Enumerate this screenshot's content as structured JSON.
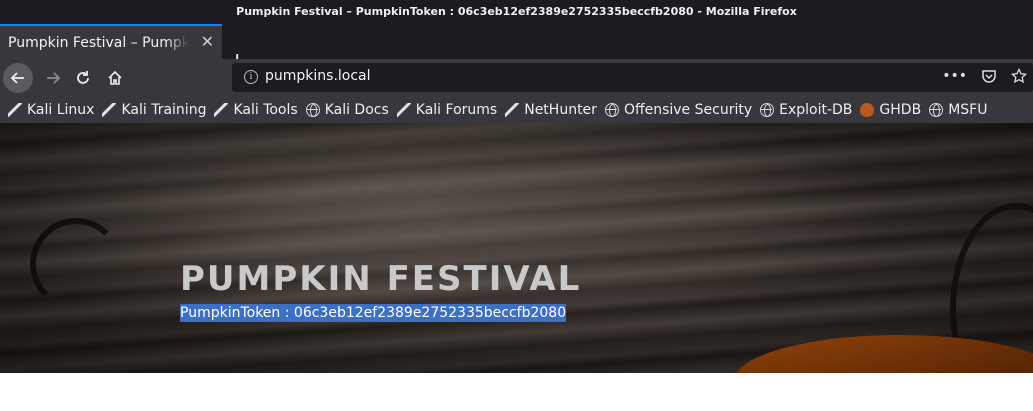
{
  "window": {
    "title": "Pumpkin Festival – PumpkinToken : 06c3eb12ef2389e2752335beccfb2080 - Mozilla Firefox"
  },
  "tabs": [
    {
      "label": "Pumpkin Festival – Pumpkin"
    }
  ],
  "navigation": {
    "url": "pumpkins.local",
    "page_actions": "•••"
  },
  "bookmarks": [
    {
      "label": "Kali Linux",
      "icon": "kali-icon"
    },
    {
      "label": "Kali Training",
      "icon": "kali-icon"
    },
    {
      "label": "Kali Tools",
      "icon": "kali-icon"
    },
    {
      "label": "Kali Docs",
      "icon": "globe-icon"
    },
    {
      "label": "Kali Forums",
      "icon": "kali-icon"
    },
    {
      "label": "NetHunter",
      "icon": "kali-icon"
    },
    {
      "label": "Offensive Security",
      "icon": "globe-icon"
    },
    {
      "label": "Exploit-DB",
      "icon": "globe-icon"
    },
    {
      "label": "GHDB",
      "icon": "ghdb-icon"
    },
    {
      "label": "MSFU",
      "icon": "globe-icon"
    }
  ],
  "page": {
    "heading": "PUMPKIN FESTIVAL",
    "token": "PumpkinToken : 06c3eb12ef2389e2752335beccfb2080",
    "selection_color": "#3d70c2"
  }
}
